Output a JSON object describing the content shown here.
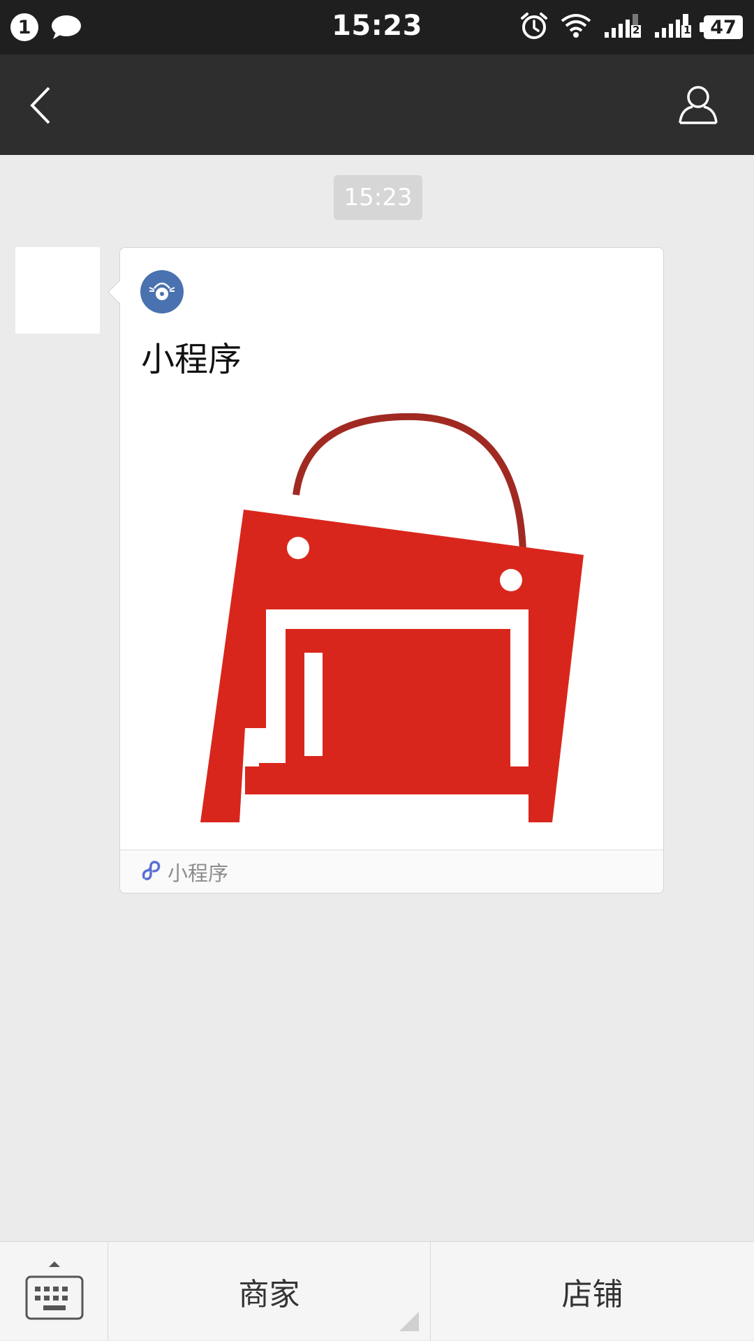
{
  "status_bar": {
    "notification_count": "1",
    "time": "15:23",
    "battery": "47",
    "sim1_label": "2",
    "sim2_label": "1",
    "icons": [
      "chat-bubble-icon",
      "alarm-icon",
      "wifi-icon",
      "signal-icon",
      "signal-icon",
      "battery-icon"
    ]
  },
  "nav": {
    "back_icon": "chevron-left-icon",
    "profile_icon": "person-icon"
  },
  "chat": {
    "timestamp": "15:23",
    "message": {
      "title": "小程序",
      "footer_label": "小程序",
      "footer_icon": "mini-program-icon",
      "image": "red-shopping-bag-logo"
    }
  },
  "bottom_menu": {
    "keyboard_icon": "keyboard-icon",
    "items": [
      {
        "label": "商家",
        "has_submenu": true
      },
      {
        "label": "店铺",
        "has_submenu": false
      }
    ]
  },
  "colors": {
    "status_bar": "#1f1f1f",
    "nav_bar": "#2e2e2e",
    "background": "#ebebeb",
    "logo_blue": "#4a72b0",
    "bag_red": "#d9261c"
  }
}
